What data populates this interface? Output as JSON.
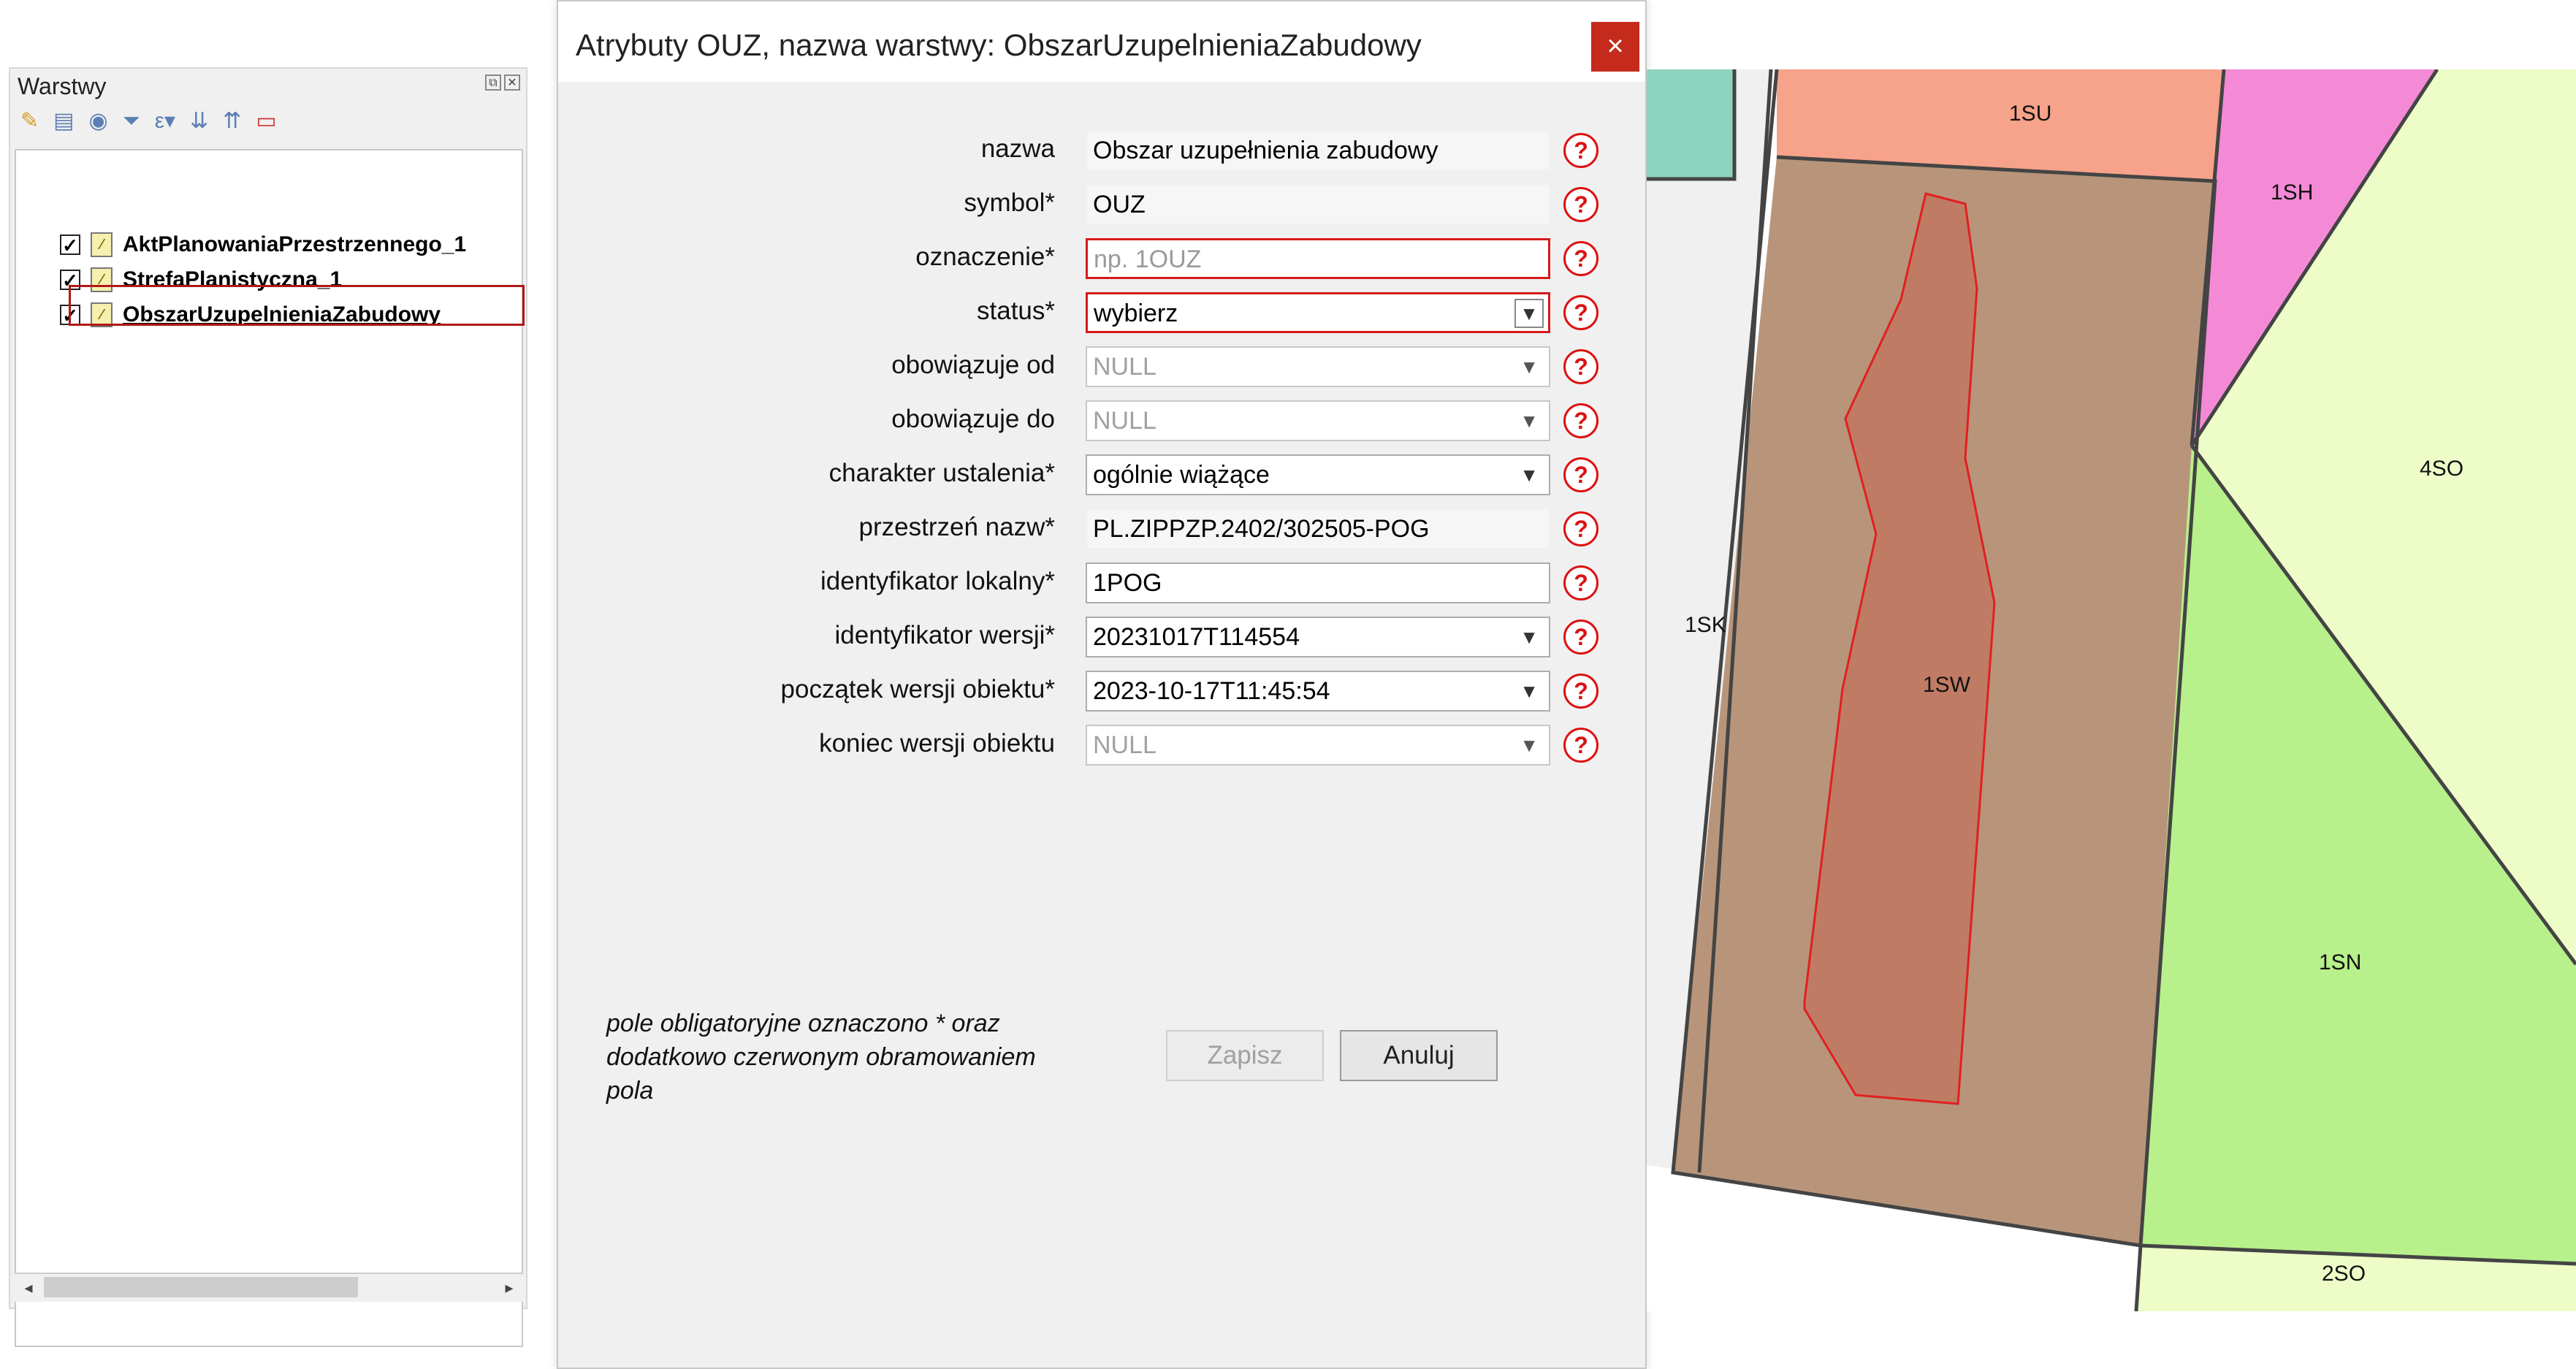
{
  "layers_panel": {
    "title": "Warstwy",
    "toolbar": [
      "paint-brush-icon",
      "add-layer-icon",
      "eye-icon",
      "filter-icon",
      "expression-icon",
      "expand-icon",
      "collapse-icon",
      "remove-layer-icon"
    ],
    "layers": [
      {
        "name": "AktPlanowaniaPrzestrzennego_1",
        "checked": true
      },
      {
        "name": "StrefaPlanistyczna_1",
        "checked": true
      },
      {
        "name": "ObszarUzupelnieniaZabudowy",
        "checked": true,
        "selected": true
      }
    ]
  },
  "dialog": {
    "title": "Atrybuty OUZ, nazwa warstwy: ObszarUzupelnieniaZabudowy",
    "close": "×",
    "fields": [
      {
        "label": "nazwa",
        "value": "Obszar uzupełnienia zabudowy"
      },
      {
        "label": "symbol*",
        "value": "OUZ"
      },
      {
        "label": "oznaczenie*",
        "placeholder": "np. 1OUZ"
      },
      {
        "label": "status*",
        "value": "wybierz"
      },
      {
        "label": "obowiązuje od",
        "value": "NULL"
      },
      {
        "label": "obowiązuje do",
        "value": "NULL"
      },
      {
        "label": "charakter ustalenia*",
        "value": "ogólnie wiążące"
      },
      {
        "label": "przestrzeń nazw*",
        "value": "PL.ZIPPZP.2402/302505-POG"
      },
      {
        "label": "identyfikator lokalny*",
        "value": "1POG"
      },
      {
        "label": "identyfikator wersji*",
        "value": "20231017T114554"
      },
      {
        "label": "początek wersji obiektu*",
        "value": "2023-10-17T11:45:54"
      },
      {
        "label": "koniec wersji obiektu",
        "value": "NULL"
      }
    ],
    "note": "pole obligatoryjne oznaczono * oraz dodatkowo czerwonym obramowaniem pola",
    "save": "Zapisz",
    "cancel": "Anuluj",
    "help_symbol": "?"
  },
  "map": {
    "labels": [
      "1SU",
      "1SH",
      "4SO",
      "1SK",
      "1SW",
      "1SN",
      "2SO"
    ],
    "colors": {
      "SU": "#f7a28b",
      "SH": "#f48ad6",
      "SO": "#eefcc8",
      "SN": "#b8f08c",
      "SW": "#b8957a",
      "SK": "#f0f0f0",
      "teal": "#8dd3c0",
      "ouz_fill": "#c07b64",
      "ouz_stroke": "#e02020"
    }
  }
}
